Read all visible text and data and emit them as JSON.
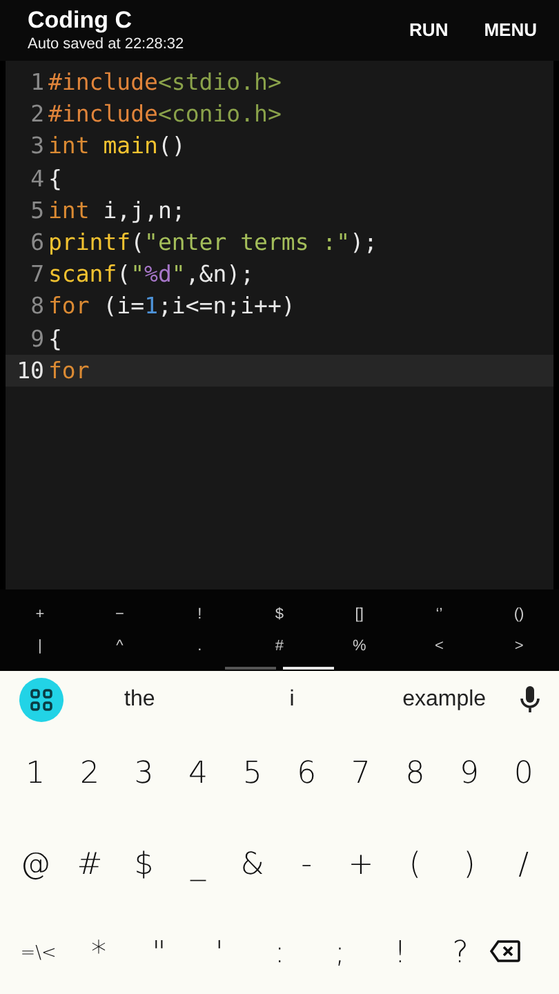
{
  "app_bar": {
    "title": "Coding C",
    "subtitle": "Auto saved at 22:28:32",
    "actions": [
      "RUN",
      "MENU"
    ]
  },
  "editor": {
    "lines": [
      {
        "number": "1",
        "current": false,
        "tokens": [
          {
            "kind": "directive",
            "text": "#include"
          },
          {
            "kind": "header",
            "text": "<stdio.h>"
          }
        ]
      },
      {
        "number": "2",
        "current": false,
        "tokens": [
          {
            "kind": "directive",
            "text": "#include"
          },
          {
            "kind": "header",
            "text": "<conio.h>"
          }
        ]
      },
      {
        "number": "3",
        "current": false,
        "tokens": [
          {
            "kind": "keyword",
            "text": "int "
          },
          {
            "kind": "function",
            "text": "main"
          },
          {
            "kind": "plain",
            "text": "()"
          }
        ]
      },
      {
        "number": "4",
        "current": false,
        "tokens": [
          {
            "kind": "plain",
            "text": "{"
          }
        ]
      },
      {
        "number": "5",
        "current": false,
        "tokens": [
          {
            "kind": "keyword",
            "text": "int "
          },
          {
            "kind": "plain",
            "text": "i,j,n;"
          }
        ]
      },
      {
        "number": "6",
        "current": false,
        "tokens": [
          {
            "kind": "function",
            "text": "printf"
          },
          {
            "kind": "plain",
            "text": "("
          },
          {
            "kind": "string",
            "text": "\"enter terms :\""
          },
          {
            "kind": "plain",
            "text": ");"
          }
        ]
      },
      {
        "number": "7",
        "current": false,
        "tokens": [
          {
            "kind": "function",
            "text": "scanf"
          },
          {
            "kind": "plain",
            "text": "("
          },
          {
            "kind": "string",
            "text": "\""
          },
          {
            "kind": "format",
            "text": "%d"
          },
          {
            "kind": "string",
            "text": "\""
          },
          {
            "kind": "plain",
            "text": ",&n);"
          }
        ]
      },
      {
        "number": "8",
        "current": false,
        "tokens": [
          {
            "kind": "keyword",
            "text": "for "
          },
          {
            "kind": "plain",
            "text": "(i="
          },
          {
            "kind": "number",
            "text": "1"
          },
          {
            "kind": "plain",
            "text": ";i<=n;i++)"
          }
        ]
      },
      {
        "number": "9",
        "current": false,
        "tokens": [
          {
            "kind": "plain",
            "text": "{"
          }
        ]
      },
      {
        "number": "10",
        "current": true,
        "tokens": [
          {
            "kind": "keyword",
            "text": "for"
          }
        ]
      }
    ]
  },
  "symbol_bar": {
    "rows": [
      [
        "+",
        "−",
        "!",
        "$",
        "[]",
        "‘’",
        "()"
      ],
      [
        "|",
        "^",
        ".",
        "#",
        "%",
        "<",
        ">"
      ]
    ],
    "pages": [
      {
        "selected": false
      },
      {
        "selected": true
      }
    ]
  },
  "keyboard": {
    "suggestions": [
      "the",
      "i",
      "example"
    ],
    "rows": [
      [
        "1",
        "2",
        "3",
        "4",
        "5",
        "6",
        "7",
        "8",
        "9",
        "0"
      ],
      [
        "@",
        "#",
        "$",
        "_",
        "&",
        "-",
        "+",
        "(",
        ")",
        "/"
      ],
      [
        "=\\<",
        "*",
        "\"",
        "'",
        ":",
        ";",
        "!",
        "?"
      ]
    ]
  }
}
